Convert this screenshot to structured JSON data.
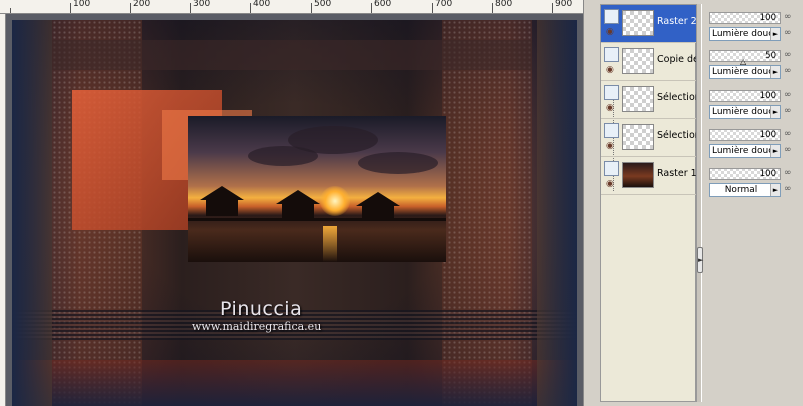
{
  "ruler": {
    "ticks": [
      "100",
      "200",
      "300",
      "400",
      "500",
      "600",
      "700",
      "800",
      "900"
    ]
  },
  "artwork": {
    "title": "Pinuccia",
    "url": "www.maidiregrafica.eu"
  },
  "layers": [
    {
      "name": "Raster 2",
      "selected": true,
      "thumb": "transparent"
    },
    {
      "name": "Copie de",
      "selected": false,
      "thumb": "transparent"
    },
    {
      "name": "Sélection",
      "selected": false,
      "thumb": "transparent"
    },
    {
      "name": "Sélection",
      "selected": false,
      "thumb": "transparent"
    },
    {
      "name": "Raster 1",
      "selected": false,
      "thumb": "photo"
    }
  ],
  "properties": [
    {
      "opacity": "100",
      "blend": "Lumière douce"
    },
    {
      "opacity": "50",
      "blend": "Lumière douce"
    },
    {
      "opacity": "100",
      "blend": "Lumière douce"
    },
    {
      "opacity": "100",
      "blend": "Lumière douce"
    },
    {
      "opacity": "100",
      "blend": "Normal"
    }
  ],
  "colors": {
    "selection": "#3161c6",
    "panel": "#d4d0c8"
  },
  "icons": {
    "visibility": "eye-icon",
    "layer_type": "raster-layer-icon",
    "lock": "lock-icon",
    "link": "link-icon",
    "dropdown": "chevron-right-icon"
  }
}
